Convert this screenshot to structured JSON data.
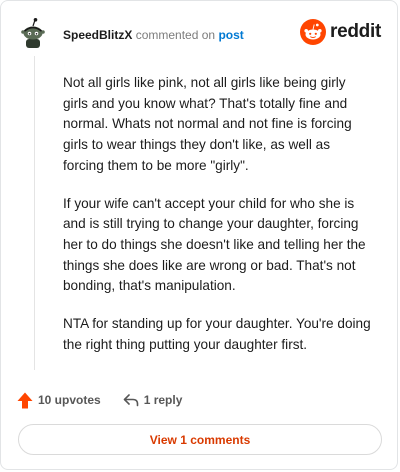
{
  "header": {
    "username": "SpeedBlitzX",
    "action": "commented on",
    "target": "post",
    "logo_text": "reddit"
  },
  "comment": {
    "paragraphs": [
      "Not all girls like pink, not all girls like being girly girls and you know what? That's totally fine and normal. Whats not normal and not fine is forcing girls to wear things they don't like, as well as forcing them to be more \"girly\".",
      "If your wife can't accept your child for who she is and is still trying to change your daughter, forcing her to do things she doesn't like and telling her the things she does like are wrong or bad. That's not bonding, that's manipulation.",
      "NTA for standing up for your daughter. You're doing the right thing putting your daughter first."
    ]
  },
  "actions": {
    "upvotes": "10 upvotes",
    "replies": "1 reply"
  },
  "view_comments_label": "View 1 comments",
  "colors": {
    "brand": "#ff4500",
    "link": "#0079d3",
    "view_button_text": "#d93a00"
  },
  "icons": [
    "snoo-avatar-icon",
    "reddit-logo-icon",
    "upvote-arrow-icon",
    "reply-arrow-icon"
  ]
}
